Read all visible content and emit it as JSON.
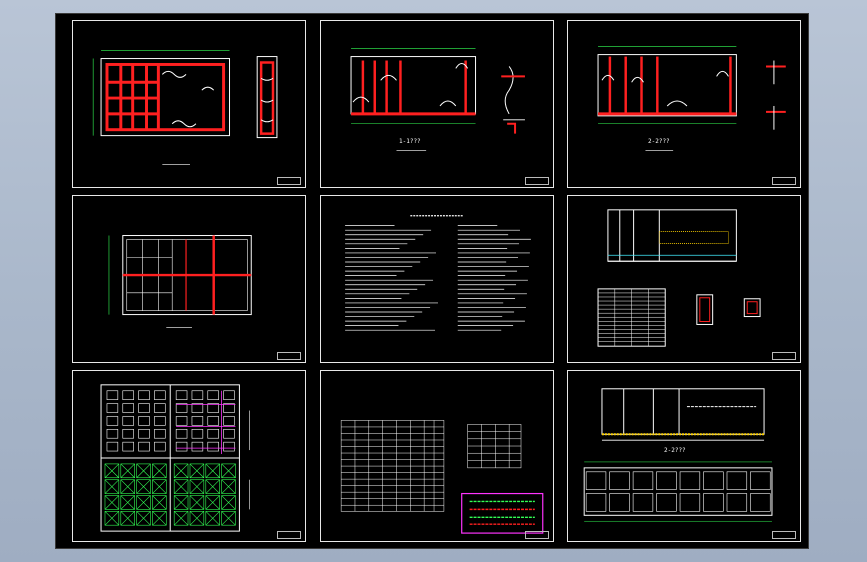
{
  "colors": {
    "background": "#000000",
    "frame": "#ffffff",
    "wall": "#ff2020",
    "pipe": "#ffffff",
    "dimension": "#33ff55",
    "magenta": "#ff33ff",
    "yellow": "#ffd200",
    "cyan": "#44eeff"
  },
  "sheets": [
    {
      "id": "s1",
      "title": "",
      "labels": []
    },
    {
      "id": "s2",
      "title": "",
      "labels": [
        "1-1???"
      ]
    },
    {
      "id": "s3",
      "title": "",
      "labels": [
        "2-2???"
      ]
    },
    {
      "id": "s4",
      "title": "",
      "labels": []
    },
    {
      "id": "s5",
      "title": "",
      "labels": []
    },
    {
      "id": "s6",
      "title": "",
      "labels": []
    },
    {
      "id": "s7",
      "title": "",
      "labels": []
    },
    {
      "id": "s8",
      "title": "",
      "labels": []
    },
    {
      "id": "s9",
      "title": "",
      "labels": [
        "2-2???"
      ]
    }
  ]
}
